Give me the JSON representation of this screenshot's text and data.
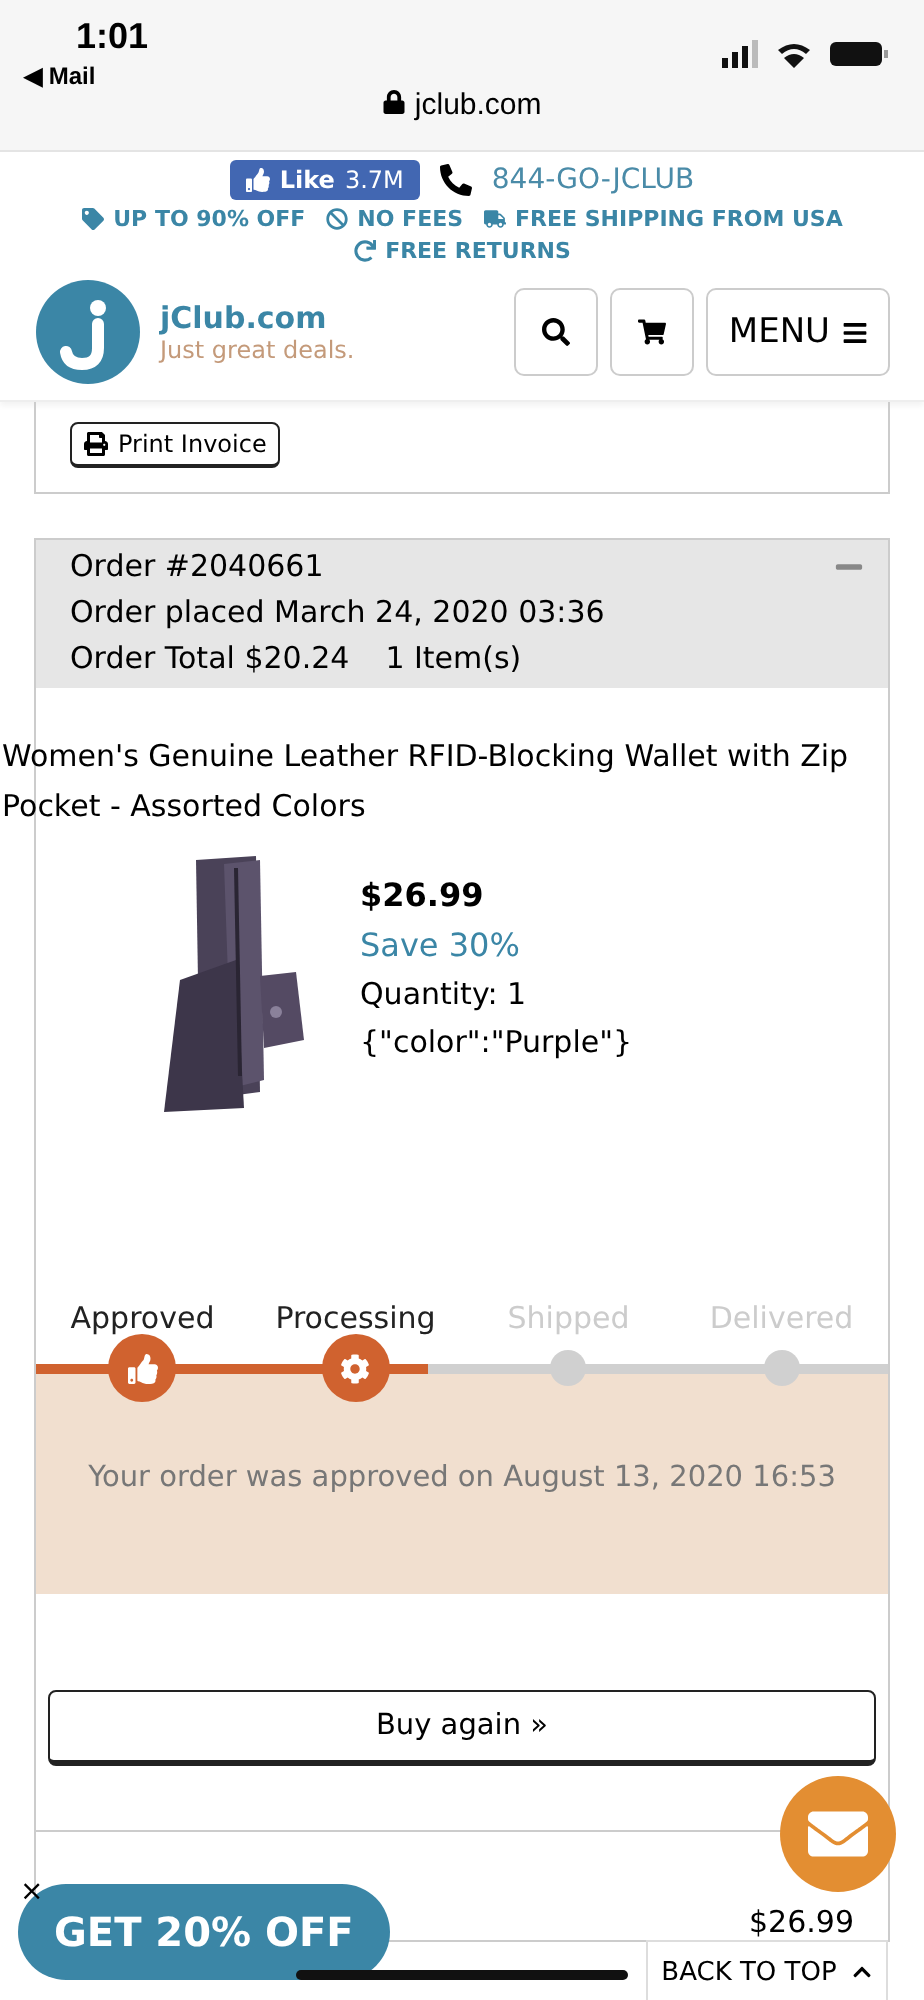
{
  "status_bar": {
    "time": "1:01",
    "back_app": "◀ Mail",
    "url": "jclub.com"
  },
  "promo": {
    "like_label": "Like",
    "like_count": "3.7M",
    "phone": "844-GO-JCLUB",
    "perks": [
      {
        "kind": "tag",
        "label": "UP TO 90% OFF"
      },
      {
        "kind": "nofee",
        "label": "NO FEES"
      },
      {
        "kind": "truck",
        "label": "FREE SHIPPING FROM USA"
      },
      {
        "kind": "returns",
        "label": "FREE RETURNS"
      }
    ]
  },
  "header": {
    "brand": "jClub.com",
    "tagline": "Just great deals.",
    "menu_label": "MENU"
  },
  "previous_order": {
    "print_label": "Print Invoice"
  },
  "order": {
    "expanded": true,
    "number": "Order #2040661",
    "placed": "Order placed March 24, 2020 03:36",
    "total": "Order Total $20.24",
    "items": "1 Item(s)",
    "product": {
      "title": "Women's Genuine Leather RFID-Blocking Wallet with Zip Pocket - Assorted Colors",
      "price": "$26.99",
      "save": "Save 30%",
      "quantity": "Quantity: 1",
      "options": "{\"color\":\"Purple\"}"
    },
    "tracker": {
      "level": 0.46,
      "steps": [
        {
          "label": "Approved",
          "done": true,
          "kind": "thumb"
        },
        {
          "label": "Processing",
          "done": true,
          "kind": "gear"
        },
        {
          "label": "Shipped",
          "done": false,
          "kind": "dot"
        },
        {
          "label": "Delivered",
          "done": false,
          "kind": "dot"
        }
      ],
      "message": "Your order was approved on August 13, 2020 16:53"
    },
    "buy_again": "Buy again »",
    "summary": [
      {
        "value": "$26.99"
      }
    ]
  },
  "overlays": {
    "discount": "GET 20% OFF",
    "close": "×",
    "back_to_top": "BACK TO TOP"
  }
}
